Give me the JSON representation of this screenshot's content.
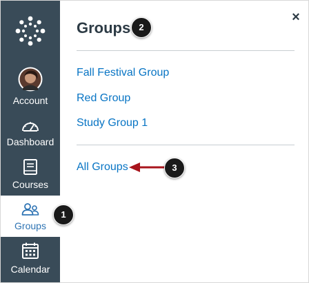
{
  "sidebar": {
    "logo_icon": "canvas-logo-icon",
    "items": [
      {
        "label": "Account",
        "icon": "user-avatar-icon"
      },
      {
        "label": "Dashboard",
        "icon": "dashboard-gauge-icon"
      },
      {
        "label": "Courses",
        "icon": "book-icon"
      },
      {
        "label": "Groups",
        "icon": "groups-people-icon",
        "active": true
      },
      {
        "label": "Calendar",
        "icon": "calendar-icon"
      }
    ]
  },
  "tray": {
    "title": "Groups",
    "close_label": "×",
    "groups": [
      "Fall Festival Group",
      "Red Group",
      "Study Group 1"
    ],
    "all_groups_label": "All Groups"
  },
  "callouts": [
    "1",
    "2",
    "3"
  ],
  "colors": {
    "sidebar_bg": "#394b58",
    "active_item": "#2d73b3",
    "link": "#0774c4",
    "arrow": "#a8141c"
  }
}
